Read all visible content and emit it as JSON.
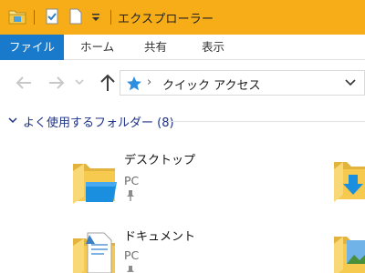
{
  "window": {
    "title": "エクスプローラー"
  },
  "ribbon": {
    "tabs": [
      {
        "label": "ファイル"
      },
      {
        "label": "ホーム"
      },
      {
        "label": "共有"
      },
      {
        "label": "表示"
      }
    ]
  },
  "navigation": {
    "address": {
      "path_label": "クイック アクセス"
    }
  },
  "quick_access": {
    "section_label": "よく使用するフォルダー (8)",
    "folders": [
      {
        "name": "デスクトップ",
        "location": "PC",
        "icon": "desktop-folder-icon"
      },
      {
        "name": "ドキュメント",
        "location": "PC",
        "icon": "documents-folder-icon"
      }
    ]
  },
  "colors": {
    "titlebar": "#f6ad17",
    "file_tab": "#1979ca",
    "section_header_text": "#1e3287",
    "folder_yellow": "#f6c94f"
  }
}
